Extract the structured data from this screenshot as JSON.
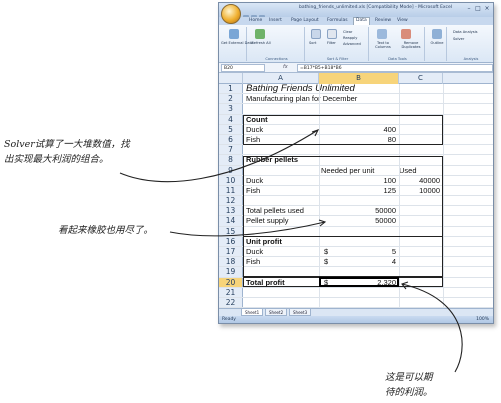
{
  "window": {
    "title": "bathing_friends_unlimited.xls [Compatibility Mode] - Microsoft Excel",
    "tabs": [
      "Home",
      "Insert",
      "Page Layout",
      "Formulas",
      "Data",
      "Review",
      "View"
    ],
    "active_tab": "Data",
    "ribbon": {
      "groups": [
        {
          "label": "Get External Data",
          "items": [
            "Get External Data"
          ]
        },
        {
          "label": "Connections",
          "items": [
            "Refresh All"
          ]
        },
        {
          "label": "Sort & Filter",
          "items": [
            "Sort",
            "Filter",
            "Clear",
            "Reapply",
            "Advanced"
          ]
        },
        {
          "label": "Data Tools",
          "items": [
            "Text to Columns",
            "Remove Duplicates"
          ]
        },
        {
          "label": "Outline",
          "items": [
            "Outline"
          ]
        },
        {
          "label": "Analysis",
          "items": [
            "Data Analysis",
            "Solver"
          ]
        }
      ]
    },
    "name_box": "B20",
    "fx": "fx",
    "formula": "=B17*B5+B18*B6"
  },
  "sheet": {
    "columns": [
      "A",
      "B",
      "C"
    ],
    "selected_column": "B",
    "selected_row": "20",
    "rows": [
      {
        "n": "1",
        "A": "Bathing Friends Unlimited",
        "B": "",
        "C": ""
      },
      {
        "n": "2",
        "A": "Manufacturing plan for December",
        "B": "",
        "C": ""
      },
      {
        "n": "3",
        "A": "",
        "B": "",
        "C": ""
      },
      {
        "n": "4",
        "A": "Count",
        "B": "",
        "C": ""
      },
      {
        "n": "5",
        "A": "Duck",
        "B": "400",
        "C": ""
      },
      {
        "n": "6",
        "A": "Fish",
        "B": "80",
        "C": ""
      },
      {
        "n": "7",
        "A": "",
        "B": "",
        "C": ""
      },
      {
        "n": "8",
        "A": "Rubber pellets",
        "B": "",
        "C": ""
      },
      {
        "n": "9",
        "A": "",
        "B": "Needed per unit",
        "C": "Used"
      },
      {
        "n": "10",
        "A": "Duck",
        "B": "100",
        "C": "40000"
      },
      {
        "n": "11",
        "A": "Fish",
        "B": "125",
        "C": "10000"
      },
      {
        "n": "12",
        "A": "",
        "B": "",
        "C": ""
      },
      {
        "n": "13",
        "A": "Total pellets used",
        "B": "50000",
        "C": ""
      },
      {
        "n": "14",
        "A": "Pellet supply",
        "B": "50000",
        "C": ""
      },
      {
        "n": "15",
        "A": "",
        "B": "",
        "C": ""
      },
      {
        "n": "16",
        "A": "Unit profit",
        "B": "",
        "C": ""
      },
      {
        "n": "17",
        "A": "Duck",
        "B_cur": "$",
        "B": "5",
        "C": ""
      },
      {
        "n": "18",
        "A": "Fish",
        "B_cur": "$",
        "B": "4",
        "C": ""
      },
      {
        "n": "19",
        "A": "",
        "B": "",
        "C": ""
      },
      {
        "n": "20",
        "A": "Total profit",
        "B_cur": "$",
        "B": "2,320",
        "C": ""
      },
      {
        "n": "21",
        "A": "",
        "B": "",
        "C": ""
      },
      {
        "n": "22",
        "A": "",
        "B": "",
        "C": ""
      },
      {
        "n": "23",
        "A": "",
        "B": "",
        "C": ""
      },
      {
        "n": "24",
        "A": "",
        "B": "",
        "C": ""
      },
      {
        "n": "25",
        "A": "",
        "B": "",
        "C": ""
      },
      {
        "n": "26",
        "A": "",
        "B": "",
        "C": ""
      },
      {
        "n": "27",
        "A": "",
        "B": "",
        "C": ""
      },
      {
        "n": "28",
        "A": "",
        "B": "",
        "C": ""
      },
      {
        "n": "29",
        "A": "",
        "B": "",
        "C": ""
      }
    ],
    "sheet_tabs": [
      "Sheet1",
      "Sheet2",
      "Sheet3"
    ],
    "active_sheet": "Sheet1",
    "status": "Ready",
    "zoom": "100%"
  },
  "annotations": {
    "solver_note_line1": "Solver试算了一大堆数值，找",
    "solver_note_line2": "出实现最大利润的组合。",
    "pellets_note": "看起来橡胶也用尽了。",
    "profit_note_line1": "这是可以期",
    "profit_note_line2": "待的利润。"
  }
}
